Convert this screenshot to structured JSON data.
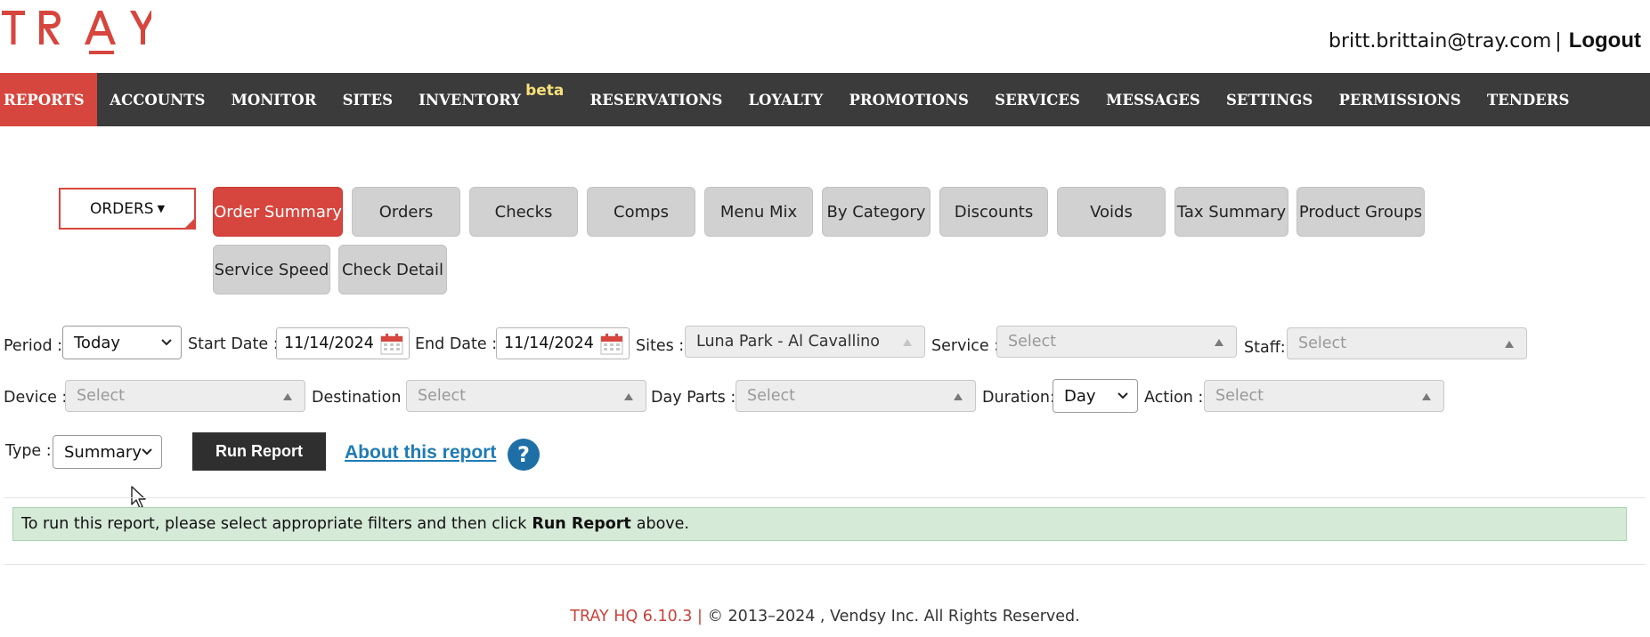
{
  "brand": {
    "logo_text": "TRAY",
    "accent_color": "#d7463e"
  },
  "header": {
    "user_email": "britt.brittain@tray.com",
    "separator": "|",
    "logout_label": "Logout"
  },
  "nav": {
    "items": [
      {
        "label": "REPORTS",
        "active": true
      },
      {
        "label": "ACCOUNTS"
      },
      {
        "label": "MONITOR"
      },
      {
        "label": "SITES"
      },
      {
        "label": "INVENTORY",
        "badge": "beta"
      },
      {
        "label": "RESERVATIONS"
      },
      {
        "label": "LOYALTY"
      },
      {
        "label": "PROMOTIONS"
      },
      {
        "label": "SERVICES"
      },
      {
        "label": "MESSAGES"
      },
      {
        "label": "SETTINGS"
      },
      {
        "label": "PERMISSIONS"
      },
      {
        "label": "TENDERS"
      }
    ]
  },
  "report_group": {
    "label": "ORDERS"
  },
  "report_tabs": [
    {
      "label": "Order Summary",
      "active": true
    },
    {
      "label": "Orders"
    },
    {
      "label": "Checks"
    },
    {
      "label": "Comps"
    },
    {
      "label": "Menu Mix"
    },
    {
      "label": "By Category"
    },
    {
      "label": "Discounts"
    },
    {
      "label": "Voids"
    },
    {
      "label": "Tax Summary"
    },
    {
      "label": "Product Groups"
    },
    {
      "label": "Service Speed"
    },
    {
      "label": "Check Detail"
    }
  ],
  "filters": {
    "period": {
      "label": "Period :",
      "value": "Today"
    },
    "start_date": {
      "label": "Start Date :",
      "value": "11/14/2024"
    },
    "end_date": {
      "label": "End Date :",
      "value": "11/14/2024"
    },
    "sites": {
      "label": "Sites :",
      "value": "Luna Park - Al Cavallino"
    },
    "service": {
      "label": "Service :",
      "placeholder": "Select"
    },
    "staff": {
      "label": "Staff:",
      "placeholder": "Select"
    },
    "device": {
      "label": "Device :",
      "placeholder": "Select"
    },
    "destination": {
      "label": "Destination :",
      "placeholder": "Select"
    },
    "day_parts": {
      "label": "Day Parts :",
      "placeholder": "Select"
    },
    "duration": {
      "label": "Duration:",
      "value": "Day"
    },
    "action": {
      "label": "Action :",
      "placeholder": "Select"
    },
    "type": {
      "label": "Type :",
      "value": "Summary"
    }
  },
  "actions": {
    "run_label": "Run Report",
    "about_label": "About this report",
    "help_glyph": "?"
  },
  "notice": {
    "before": "To run this report, please select appropriate filters and then click",
    "bold": "Run Report",
    "after": "above."
  },
  "footer": {
    "version": "TRAY HQ 6.10.3 |",
    "copyright": "© 2013–2024 , Vendsy Inc. All Rights Reserved."
  }
}
